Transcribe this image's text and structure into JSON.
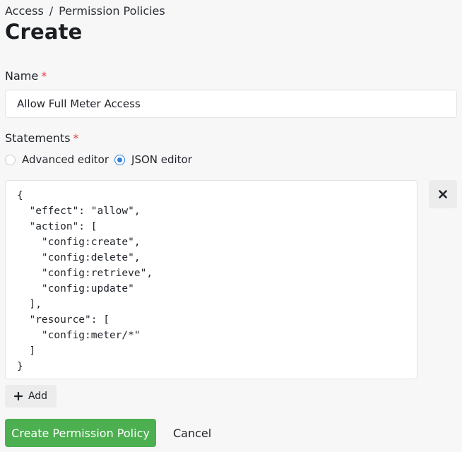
{
  "breadcrumb": {
    "items": [
      "Access",
      "Permission Policies"
    ],
    "separator": "/"
  },
  "page": {
    "title": "Create"
  },
  "form": {
    "name_label": "Name",
    "required_marker": "*",
    "name_value": "Allow Full Meter Access",
    "statements_label": "Statements",
    "editor_modes": [
      {
        "label": "Advanced editor",
        "selected": false
      },
      {
        "label": "JSON editor",
        "selected": true
      }
    ],
    "statement_json": "{\n  \"effect\": \"allow\",\n  \"action\": [\n    \"config:create\",\n    \"config:delete\",\n    \"config:retrieve\",\n    \"config:update\"\n  ],\n  \"resource\": [\n    \"config:meter/*\"\n  ]\n}",
    "add_label": "Add"
  },
  "actions": {
    "create_label": "Create Permission Policy",
    "cancel_label": "Cancel"
  },
  "icons": {
    "remove": "close-icon",
    "add": "plus-icon"
  },
  "colors": {
    "primary": "#4caf50",
    "radio_accent": "#2f7fe0",
    "required": "#e23b3b",
    "background": "#f7f7f7"
  }
}
